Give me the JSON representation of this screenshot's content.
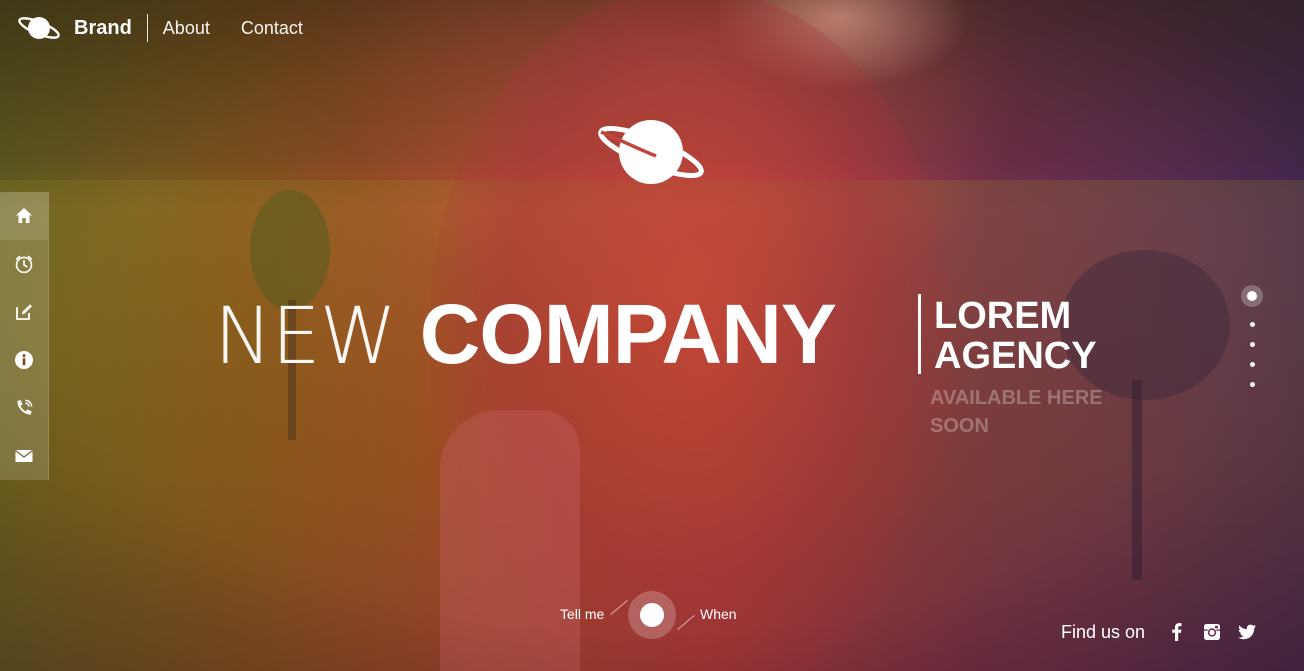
{
  "nav": {
    "brand": "Brand",
    "links": [
      {
        "label": "About"
      },
      {
        "label": "Contact"
      }
    ]
  },
  "sidebar": {
    "items": [
      {
        "icon": "home-icon"
      },
      {
        "icon": "clock-icon"
      },
      {
        "icon": "edit-icon"
      },
      {
        "icon": "info-icon"
      },
      {
        "icon": "phone-icon"
      },
      {
        "icon": "mail-icon"
      }
    ]
  },
  "hero": {
    "logo_icon": "planet-icon",
    "title_light": "NEW",
    "title_bold": "COMPANY",
    "side_line1": "LOREM",
    "side_line2": "AGENCY",
    "sub_line1": "AVAILABLE HERE",
    "sub_line2": "SOON"
  },
  "pager": {
    "total": 5,
    "active_index": 0
  },
  "toggle": {
    "left_label": "Tell me",
    "right_label": "When"
  },
  "social": {
    "label": "Find us on",
    "icons": [
      "facebook-icon",
      "instagram-icon",
      "twitter-icon"
    ]
  },
  "colors": {
    "text": "#ffffff",
    "overlay_left": "#8a5a1c",
    "overlay_center": "#b83a3a",
    "overlay_right": "#4a2a5e"
  }
}
